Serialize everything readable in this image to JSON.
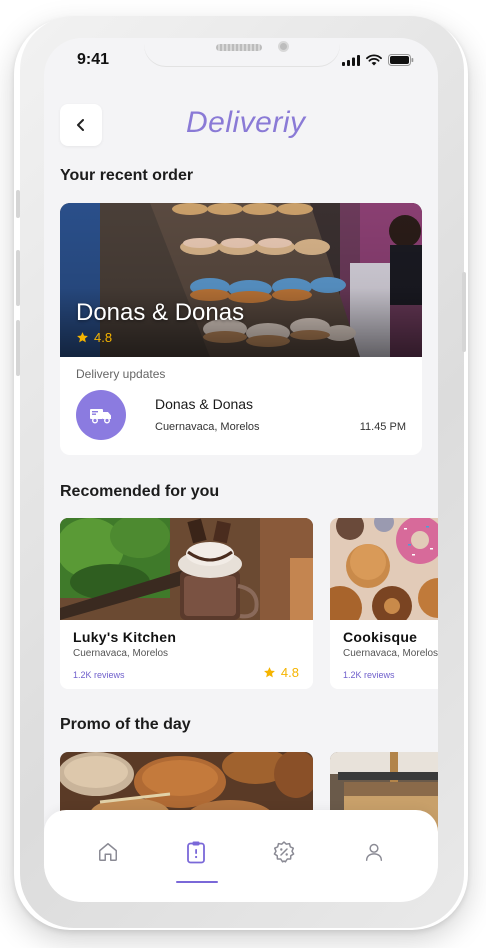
{
  "status_bar": {
    "time": "9:41"
  },
  "header": {
    "brand": "Deliveriy",
    "back_icon": "chevron-left-icon"
  },
  "recent": {
    "section_title": "Your recent order",
    "restaurant": "Donas & Donas",
    "rating": "4.8",
    "updates_label": "Delivery updates",
    "update": {
      "icon": "truck-icon",
      "name": "Donas & Donas",
      "location": "Cuernavaca, Morelos",
      "time": "11.45 PM"
    }
  },
  "recommended": {
    "section_title": "Recomended for you",
    "items": [
      {
        "name": "Luky's Kitchen",
        "location": "Cuernavaca, Morelos",
        "reviews": "1.2K reviews",
        "rating": "4.8"
      },
      {
        "name": "Cookisque",
        "location": "Cuernavaca, Morelos",
        "reviews": "1.2K reviews"
      }
    ]
  },
  "promo": {
    "section_title": "Promo of the day"
  },
  "tabbar": {
    "tabs": [
      {
        "icon": "home-icon"
      },
      {
        "icon": "orders-clipboard-icon",
        "active": true
      },
      {
        "icon": "discount-badge-icon"
      },
      {
        "icon": "profile-icon"
      }
    ]
  },
  "colors": {
    "accent": "#8b7be0",
    "star": "#f5b400",
    "background": "#f4f4f6"
  }
}
